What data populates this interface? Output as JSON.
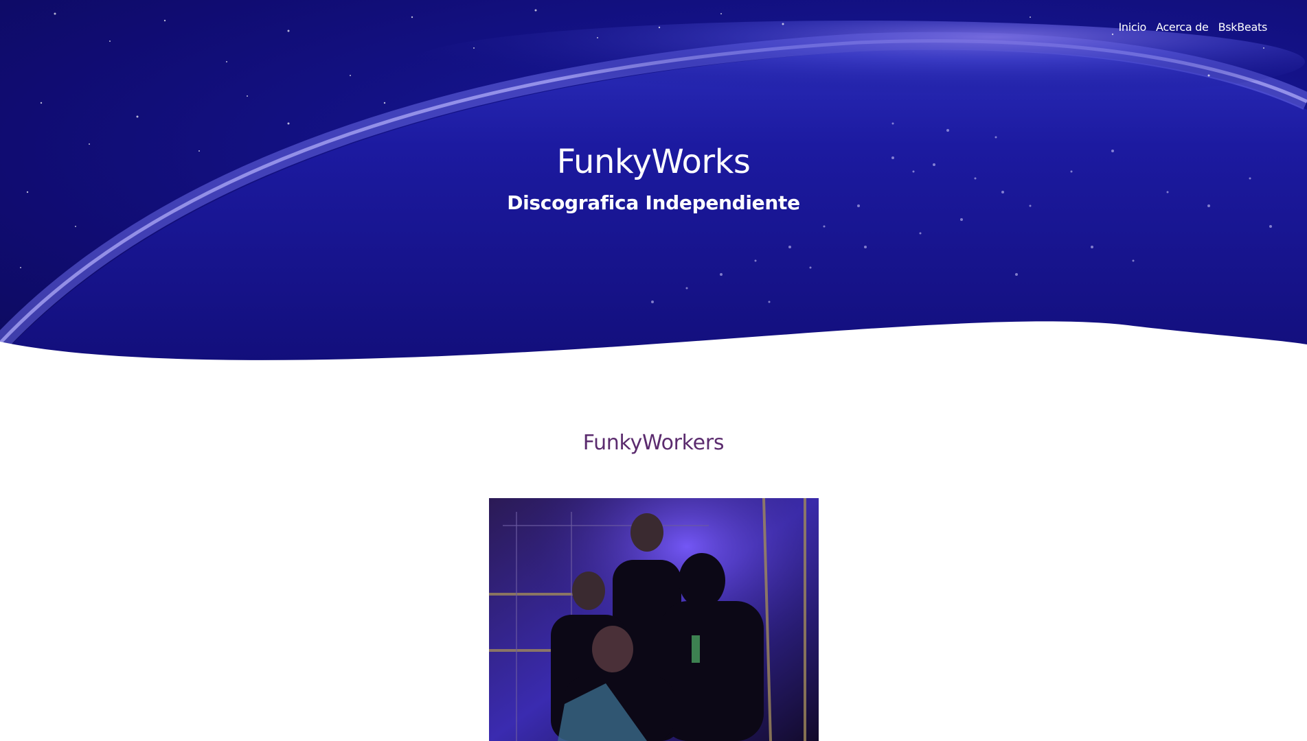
{
  "nav": {
    "items": [
      {
        "label": "Inicio"
      },
      {
        "label": "Acerca de"
      },
      {
        "label": "BskBeats"
      }
    ]
  },
  "hero": {
    "title": "FunkyWorks",
    "subtitle": "Discografica Independiente"
  },
  "main": {
    "section_title": "FunkyWorkers"
  },
  "colors": {
    "hero_bg": "#14138a",
    "section_title": "#5b2b6e",
    "page_bg": "#ffffff"
  }
}
